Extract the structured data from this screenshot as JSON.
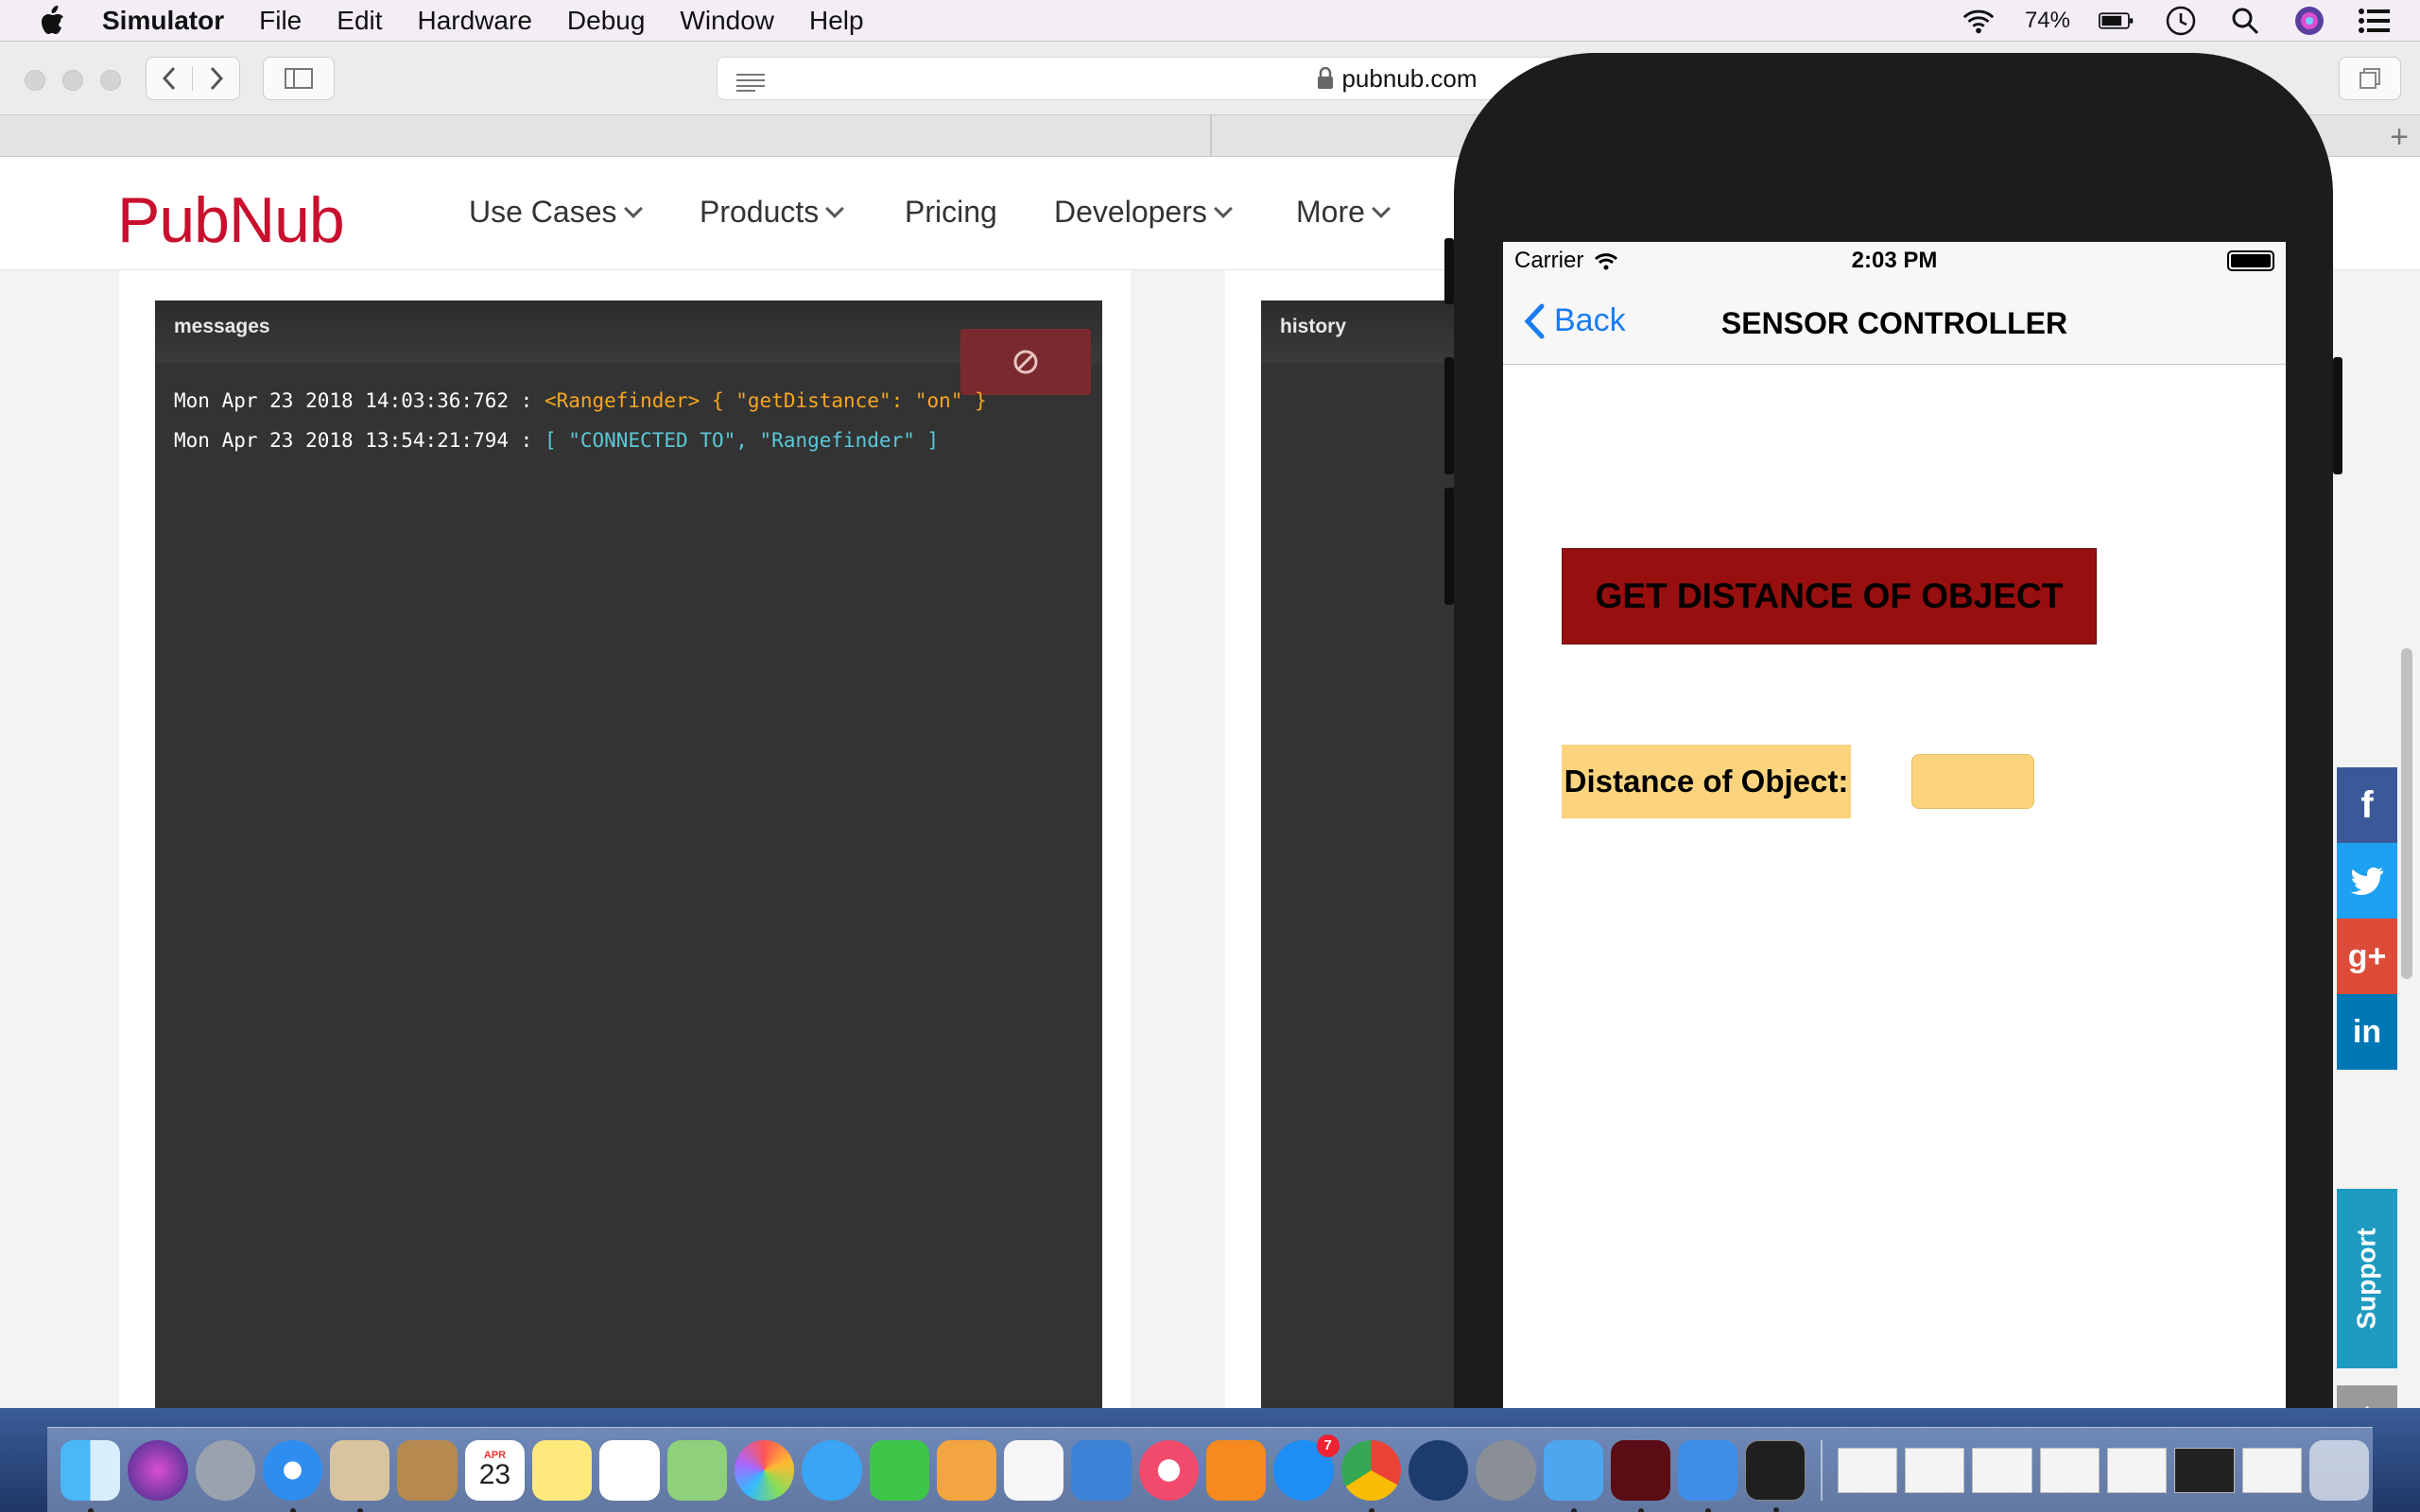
{
  "menubar": {
    "items": [
      "Simulator",
      "File",
      "Edit",
      "Hardware",
      "Debug",
      "Window",
      "Help"
    ],
    "battery_percent": "74%"
  },
  "browser": {
    "url": "pubnub.com"
  },
  "site": {
    "logo": "PubNub",
    "nav": [
      "Use Cases",
      "Products",
      "Pricing",
      "Developers",
      "More"
    ],
    "messages_panel": {
      "title": "messages",
      "lines": [
        {
          "timestamp": "Mon Apr 23 2018 14:03:36:762 :",
          "payload": "<Rangefinder> { \"getDistance\": \"on\" }"
        },
        {
          "timestamp": "Mon Apr 23 2018 13:54:21:794 :",
          "payload": "[ \"CONNECTED TO\", \"Rangefinder\" ]"
        }
      ]
    },
    "history_panel": {
      "title": "history"
    },
    "support_label": "Support",
    "social": [
      "f",
      "",
      "g+",
      "in"
    ]
  },
  "simulator": {
    "carrier": "Carrier",
    "time": "2:03 PM",
    "back_label": "Back",
    "title": "SENSOR CONTROLLER",
    "get_distance_button": "GET DISTANCE OF OBJECT",
    "distance_label": "Distance of Object:",
    "distance_value": ""
  },
  "dock": {
    "calendar_month": "APR",
    "calendar_day": "23",
    "appstore_badge": "7"
  },
  "colors": {
    "pubnub_red": "#c8102e",
    "button_red": "#980f0f",
    "label_yellow": "#fcd47e",
    "ios_blue": "#1a7cf2",
    "console_bg": "#333333",
    "support_blue": "#1f9ac1"
  }
}
